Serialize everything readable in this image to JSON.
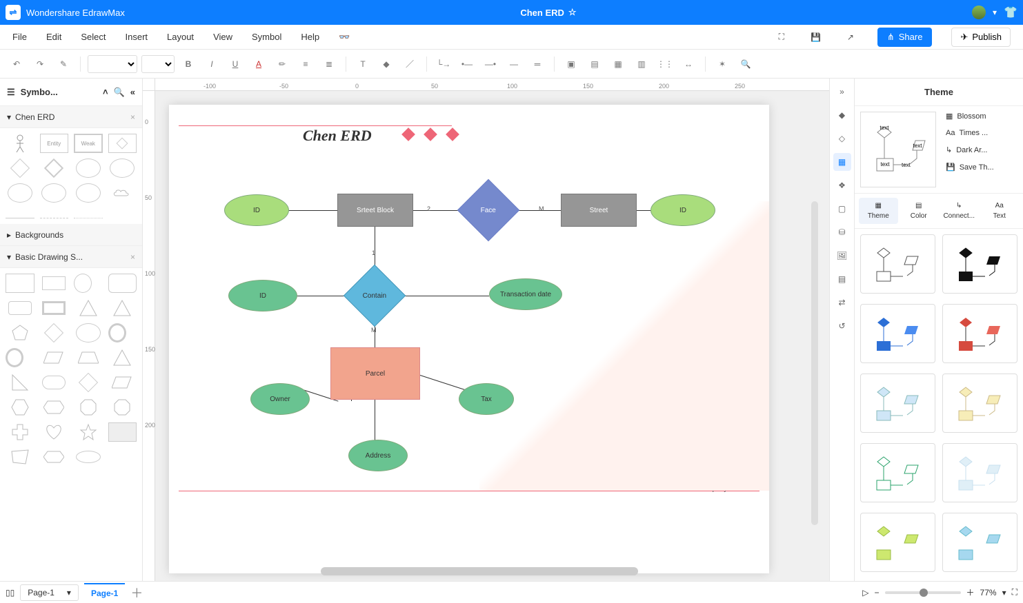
{
  "app_name": "Wondershare EdrawMax",
  "doc_title": "Chen ERD",
  "menu": [
    "File",
    "Edit",
    "Select",
    "Insert",
    "Layout",
    "View",
    "Symbol",
    "Help"
  ],
  "share_label": "Share",
  "publish_label": "Publish",
  "symbols": {
    "title": "Symbo...",
    "sections": {
      "chen": "Chen ERD",
      "backgrounds": "Backgrounds",
      "basic": "Basic Drawing S..."
    }
  },
  "diagram": {
    "title": "Chen ERD",
    "footer": "Company/ Date",
    "nodes": {
      "id1": "ID",
      "srteet_block": "Srteet Block",
      "face": "Face",
      "street": "Street",
      "id2": "ID",
      "two": "2",
      "m1": "M",
      "one": "1",
      "m2": "M",
      "id3": "ID",
      "contain": "Contain",
      "tdate": "Transaction date",
      "parcel": "Parcel",
      "owner": "Owner",
      "tax": "Tax",
      "address": "Address"
    }
  },
  "theme": {
    "title": "Theme",
    "props": {
      "blossom": "Blossom",
      "font": "Times ...",
      "connector": "Dark Ar...",
      "save": "Save Th..."
    },
    "tabs": {
      "theme": "Theme",
      "color": "Color",
      "connector": "Connect...",
      "text": "Text"
    }
  },
  "status": {
    "page_selector": "Page-1",
    "tab": "Page-1",
    "zoom": "77%"
  },
  "ruler_h": [
    "-100",
    "-50",
    "0",
    "50",
    "100",
    "150",
    "200",
    "250"
  ],
  "ruler_v": [
    "0",
    "50",
    "100",
    "150",
    "200"
  ]
}
